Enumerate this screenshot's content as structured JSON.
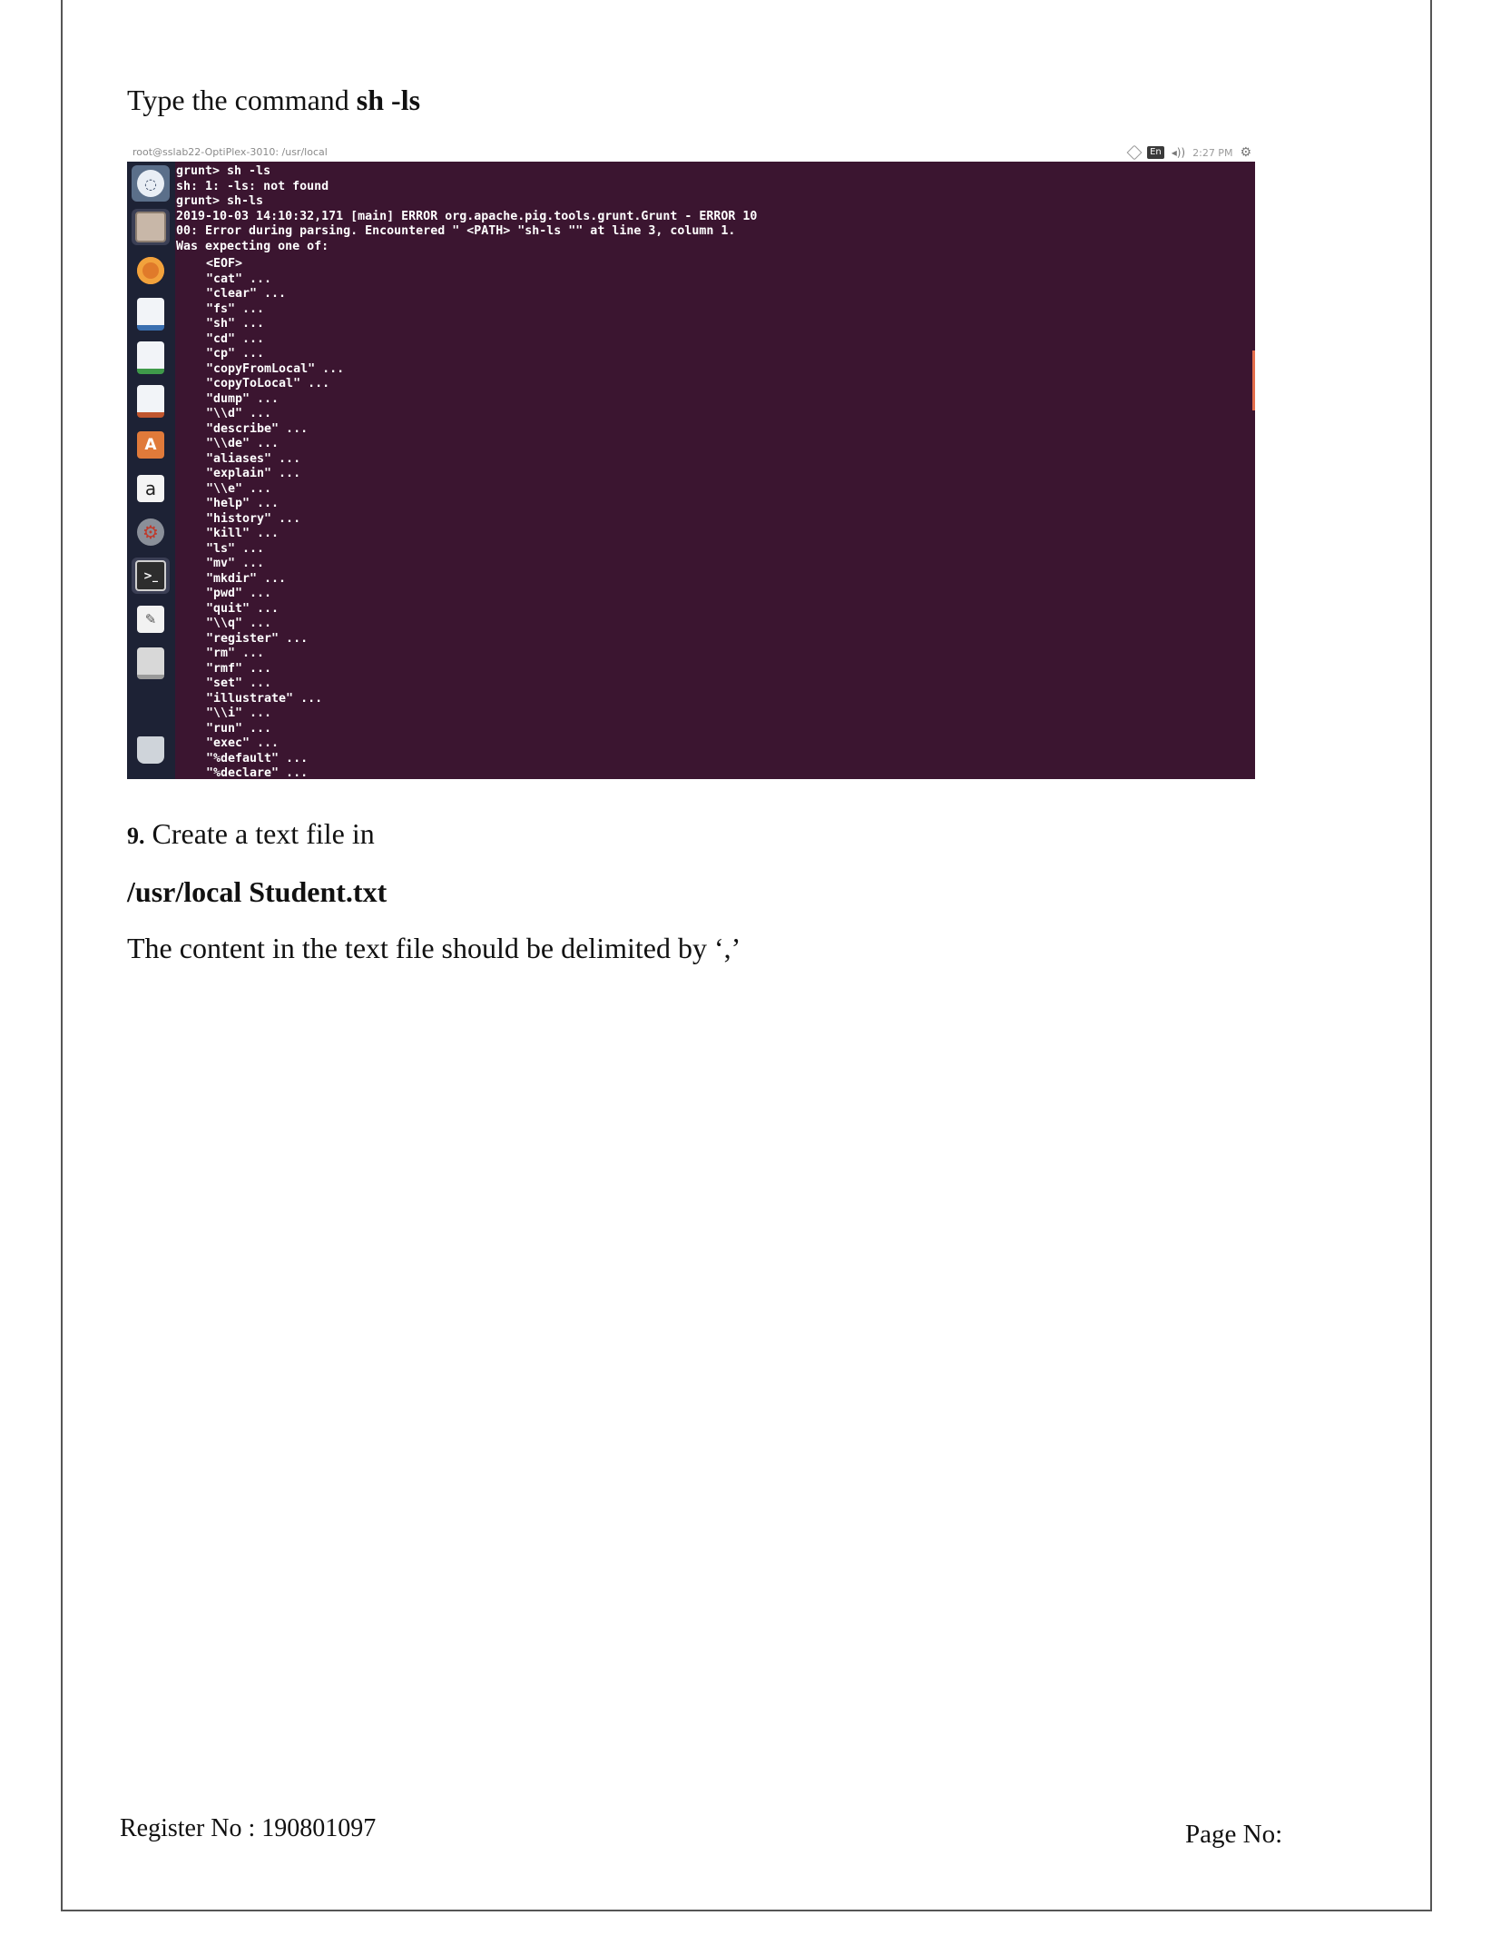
{
  "heading": {
    "prefix": "Type the command ",
    "command": "sh -ls"
  },
  "screenshot": {
    "window_title": "root@sslab22-OptiPlex-3010: /usr/local",
    "tray": {
      "keyboard": "En",
      "volume": "◂))",
      "time": "2:27 PM"
    },
    "launcher_icons": [
      "ubuntu-dash-icon",
      "files-icon",
      "firefox-icon",
      "writer-icon",
      "calc-icon",
      "impress-icon",
      "software-center-icon",
      "amazon-icon",
      "system-settings-icon",
      "terminal-icon",
      "text-editor-icon",
      "drive-icon",
      "trash-icon"
    ],
    "terminal_header_lines": [
      "grunt> sh -ls",
      "sh: 1: -ls: not found",
      "grunt> sh-ls",
      "2019-10-03 14:10:32,171 [main] ERROR org.apache.pig.tools.grunt.Grunt - ERROR 10",
      "00: Error during parsing. Encountered \" <PATH> \"sh-ls \"\" at line 3, column 1.",
      "Was expecting one of:"
    ],
    "terminal_options": [
      "<EOF>",
      "\"cat\" ...",
      "\"clear\" ...",
      "\"fs\" ...",
      "\"sh\" ...",
      "\"cd\" ...",
      "\"cp\" ...",
      "\"copyFromLocal\" ...",
      "\"copyToLocal\" ...",
      "\"dump\" ...",
      "\"\\\\d\" ...",
      "\"describe\" ...",
      "\"\\\\de\" ...",
      "\"aliases\" ...",
      "\"explain\" ...",
      "\"\\\\e\" ...",
      "\"help\" ...",
      "\"history\" ...",
      "\"kill\" ...",
      "\"ls\" ...",
      "\"mv\" ...",
      "\"mkdir\" ...",
      "\"pwd\" ...",
      "\"quit\" ...",
      "\"\\\\q\" ...",
      "\"register\" ...",
      "\"rm\" ...",
      "\"rmf\" ...",
      "\"set\" ...",
      "\"illustrate\" ...",
      "\"\\\\i\" ...",
      "\"run\" ...",
      "\"exec\" ...",
      "\"%default\" ...",
      "\"%declare\" ..."
    ]
  },
  "step": {
    "number": "9.",
    "text": " Create a text file in",
    "path": "/usr/local Student.txt",
    "note": "The content in the text file should be delimited by ‘,’"
  },
  "footer": {
    "register": "Register No : 190801097",
    "page": "Page No:"
  },
  "colors": {
    "terminal_bg": "#3b1530",
    "launcher_bg": "#1d2235"
  }
}
